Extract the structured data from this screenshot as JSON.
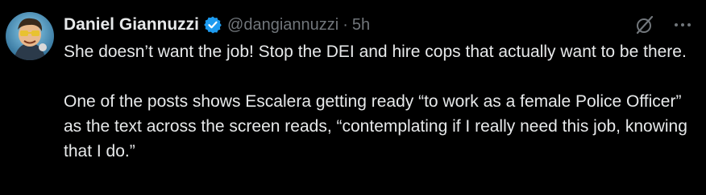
{
  "post": {
    "display_name": "Daniel Giannuzzi",
    "handle": "@dangiannuzzi",
    "separator": "·",
    "time": "5h",
    "verified": true,
    "paragraph_1": "She doesn’t want the job! Stop the DEI and hire cops that actually want to be there.",
    "paragraph_2": "One of the posts shows Escalera getting ready “to work as a female Police Officer” as the text across the screen reads, “contemplating if I really need this job, knowing that I do.”"
  },
  "icons": {
    "verified": "verified-badge-icon",
    "grok": "grok-icon",
    "more": "more-options-icon"
  },
  "colors": {
    "background": "#000000",
    "text_primary": "#e7e9ea",
    "text_secondary": "#71767b",
    "verified": "#1d9bf0"
  }
}
